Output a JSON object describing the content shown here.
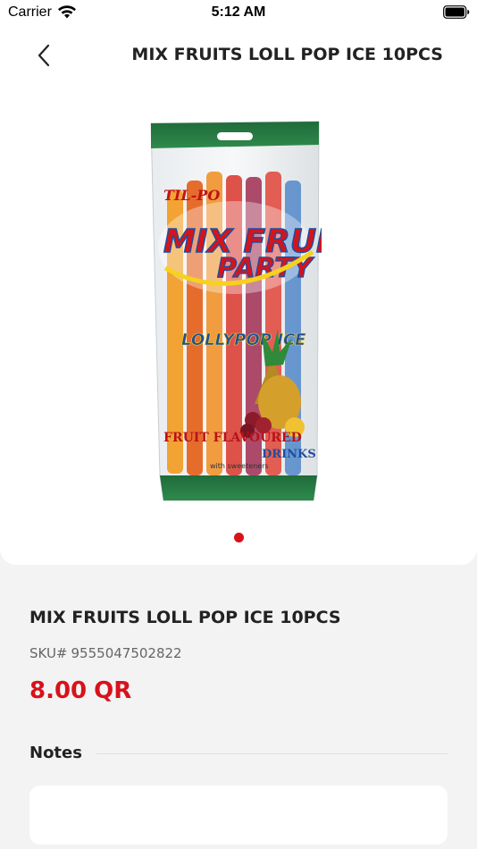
{
  "status_bar": {
    "carrier": "Carrier",
    "time": "5:12 AM"
  },
  "header": {
    "title": "MIX FRUITS LOLL POP ICE 10PCS",
    "back_icon": "chevron-left-icon"
  },
  "gallery": {
    "image_text": {
      "brand": "TIL-PO",
      "line1": "MIX FRUITS",
      "line2": "PARTY",
      "line3": "LOLLYPOP ICE",
      "line4": "FRUIT FLAVOURED",
      "line5": "DRINKS",
      "line6": "with sweeteners"
    },
    "page_count": 1,
    "active_index": 0
  },
  "product": {
    "name": "MIX FRUITS LOLL POP ICE 10PCS",
    "sku_label": "SKU#",
    "sku": "9555047502822",
    "price": "8.00",
    "currency": "QR"
  },
  "notes": {
    "heading": "Notes",
    "value": ""
  },
  "colors": {
    "accent": "#d7121b",
    "background": "#f3f3f3",
    "card": "#ffffff"
  }
}
